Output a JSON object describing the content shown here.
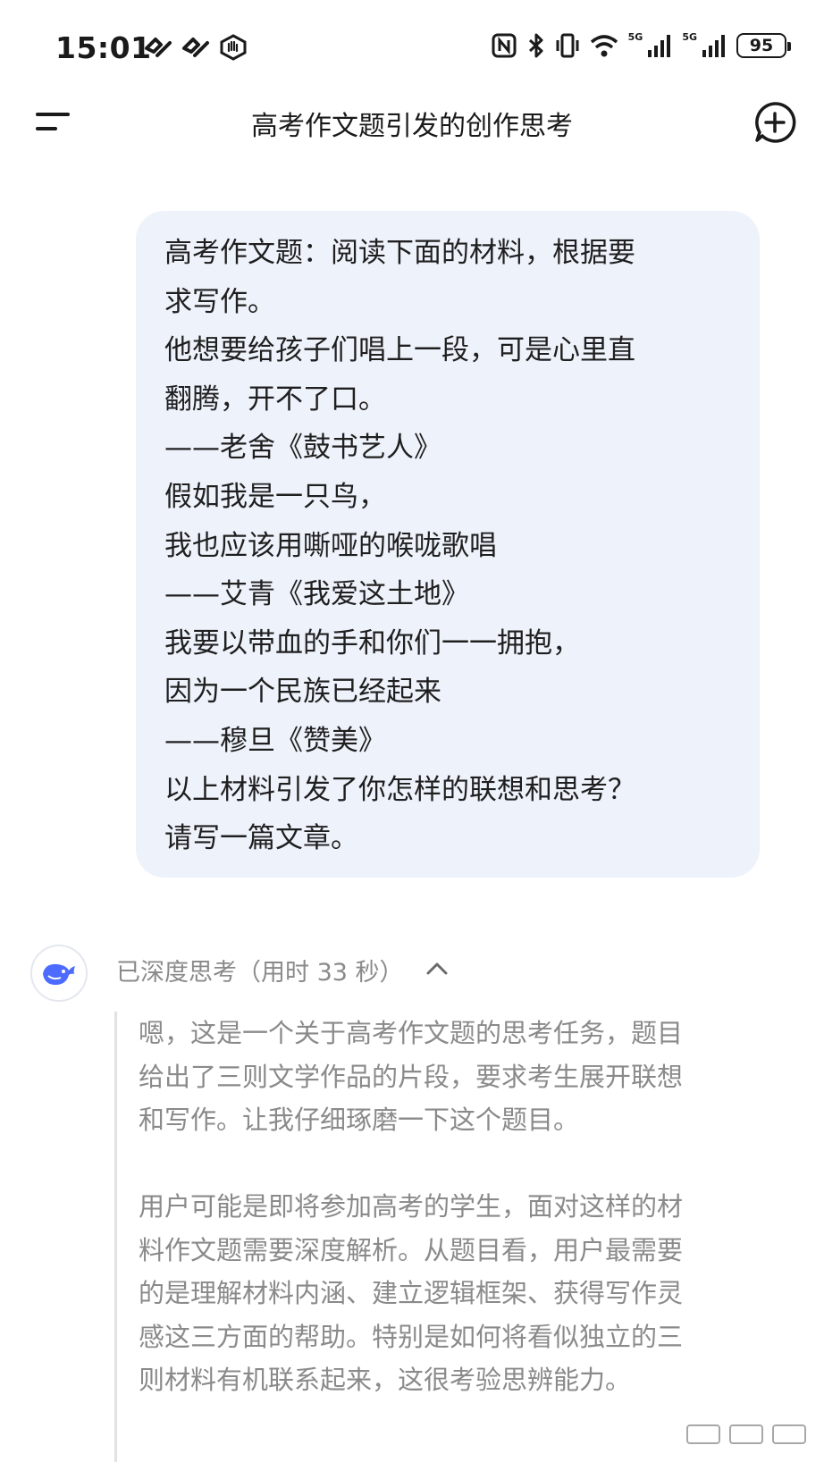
{
  "status_bar": {
    "time": "15:01",
    "battery": "95",
    "network_1": "5G",
    "network_2": "5G",
    "icons": [
      "app-notification-icon",
      "app-notification-icon",
      "hand-icon",
      "nfc-icon",
      "bluetooth-icon",
      "vibrate-icon",
      "wifi-icon",
      "signal-icon",
      "signal-icon",
      "battery-icon"
    ]
  },
  "header": {
    "title": "高考作文题引发的创作思考",
    "menu_icon": "menu-icon",
    "new_chat_icon": "new-chat-icon"
  },
  "user_message": {
    "lines": [
      "高考作文题：阅读下面的材料，根据要",
      "求写作。",
      "他想要给孩子们唱上一段，可是心里直",
      "翻腾，开不了口。",
      "——老舍《鼓书艺人》",
      "假如我是一只鸟，",
      "我也应该用嘶哑的喉咙歌唱",
      "——艾青《我爱这土地》",
      "我要以带血的手和你们一一拥抱，",
      "因为一个民族已经起来",
      "——穆旦《赞美》",
      "以上材料引发了你怎样的联想和思考？",
      "请写一篇文章。"
    ]
  },
  "thinking": {
    "label": "已深度思考（用时 33 秒）",
    "avatar_icon": "whale-logo-icon",
    "toggle_icon": "chevron-up-icon",
    "paragraph_1": [
      "嗯，这是一个关于高考作文题的思考任务，题目",
      "给出了三则文学作品的片段，要求考生展开联想",
      "和写作。让我仔细琢磨一下这个题目。"
    ],
    "paragraph_2": [
      "用户可能是即将参加高考的学生，面对这样的材",
      "料作文题需要深度解析。从题目看，用户最需要",
      "的是理解材料内涵、建立逻辑框架、获得写作灵",
      "感这三方面的帮助。特别是如何将看似独立的三",
      "则材料有机联系起来，这很考验思辨能力。"
    ]
  },
  "colors": {
    "bubble_bg": "#eef2fb",
    "muted_text": "#8a8a8a",
    "brand_blue": "#4d6bfe"
  }
}
